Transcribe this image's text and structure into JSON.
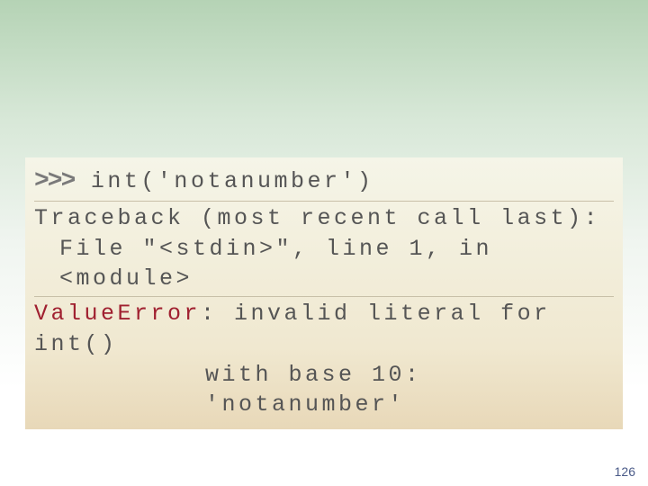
{
  "code": {
    "prompt": ">>>",
    "input": " int('notanumber')",
    "trace1": "Traceback (most recent call last):",
    "trace2": "File \"<stdin>\", line 1, in <module>",
    "err_name": "ValueError",
    "err_msg1": ": invalid literal for int()",
    "err_msg2": "with base 10: 'notanumber'"
  },
  "page_number": "126"
}
